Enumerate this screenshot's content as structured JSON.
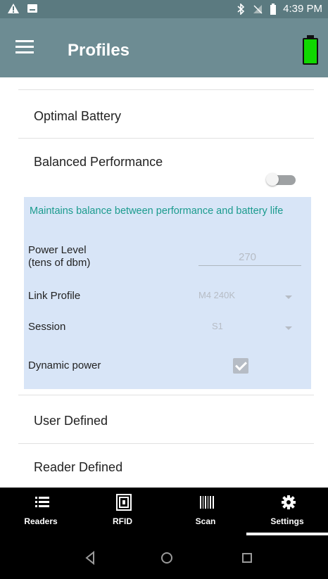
{
  "status_bar": {
    "time": "4:39 PM",
    "icons": [
      "warning-icon",
      "notification-icon",
      "bluetooth-icon",
      "no-signal-icon",
      "battery-small-icon"
    ]
  },
  "app_bar": {
    "title": "Profiles",
    "menu_icon": "menu-icon",
    "battery_icon": "battery-full-icon",
    "battery_color": "#10d800"
  },
  "profiles": {
    "items": [
      {
        "label": "Optimal Battery"
      },
      {
        "label": "Balanced Performance"
      },
      {
        "label": "User Defined"
      },
      {
        "label": "Reader Defined"
      }
    ],
    "balanced_toggle": false
  },
  "details_panel": {
    "description": "Maintains balance between performance and battery life",
    "power_level_label": "Power Level\n(tens of dbm)",
    "power_level_value": "270",
    "link_profile_label": "Link Profile",
    "link_profile_value": "M4 240K",
    "session_label": "Session",
    "session_value": "S1",
    "dynamic_power_label": "Dynamic power",
    "dynamic_power_checked": true,
    "background_color": "#d8e5f7"
  },
  "bottom_tabs": [
    {
      "label": "Readers",
      "icon": "list-icon"
    },
    {
      "label": "RFID",
      "icon": "rfid-icon"
    },
    {
      "label": "Scan",
      "icon": "barcode-icon"
    },
    {
      "label": "Settings",
      "icon": "gear-icon",
      "selected": true
    }
  ],
  "system_nav": {
    "icons": [
      "back-icon",
      "home-icon",
      "recents-icon"
    ]
  }
}
